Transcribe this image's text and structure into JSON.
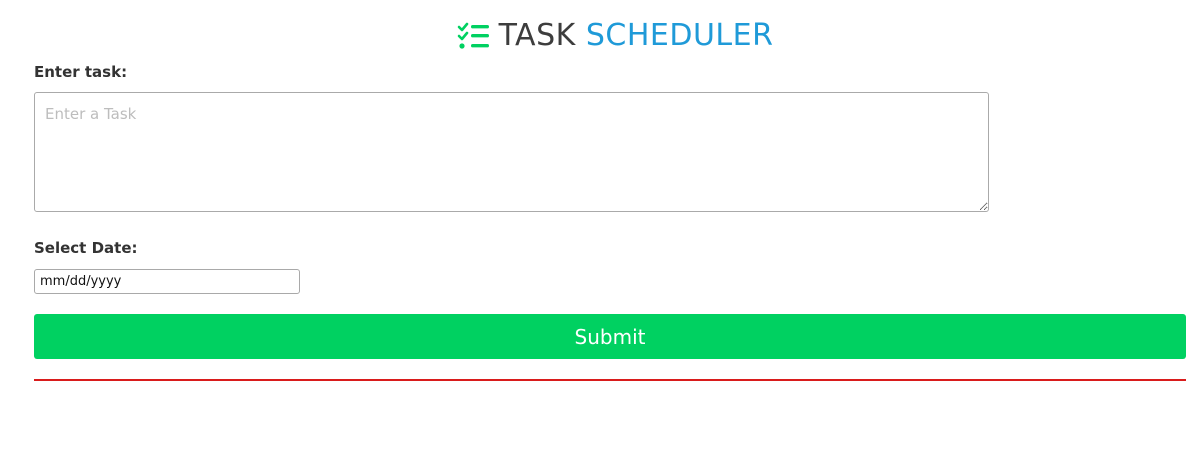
{
  "header": {
    "title_part1": "TASK",
    "title_part2": "SCHEDULER",
    "icon": "task-list-icon",
    "icon_color": "#00d161",
    "title_color_part1": "#3d3d3d",
    "title_color_part2": "#1f9ad8"
  },
  "form": {
    "task_label": "Enter task:",
    "task_placeholder": "Enter a Task",
    "task_value": "",
    "date_label": "Select Date:",
    "date_placeholder": "mm/dd/yyyy",
    "submit_label": "Submit",
    "submit_color": "#00d161"
  },
  "divider": {
    "color": "#d91c1c"
  }
}
